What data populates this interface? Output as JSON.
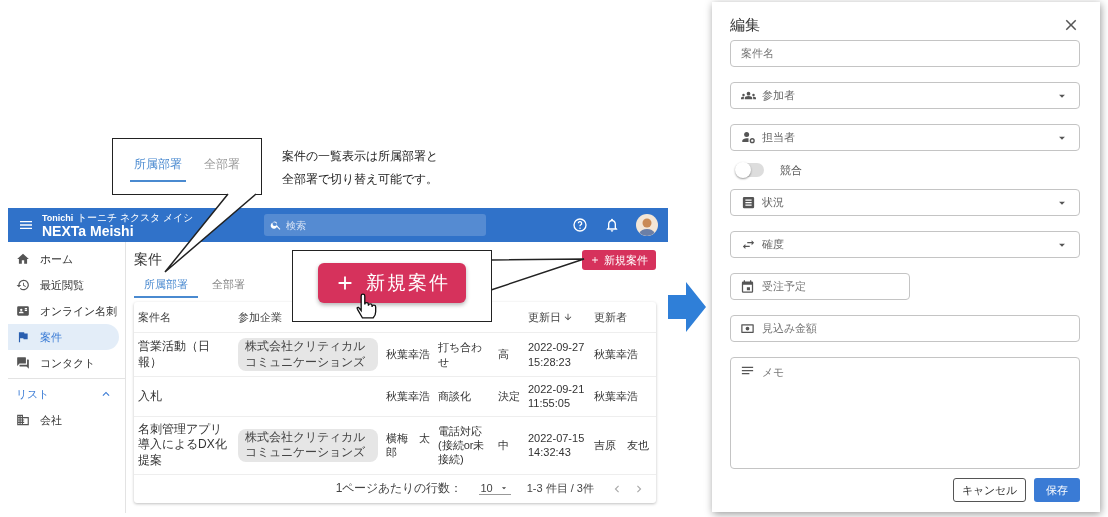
{
  "annotations": {
    "tab_bubble": {
      "tabs": [
        {
          "label": "所属部署",
          "selected": true
        },
        {
          "label": "全部署",
          "selected": false
        }
      ]
    },
    "caption": "案件の一覧表示は所属部署と全部署で切り替え可能です。",
    "button_callout": {
      "label": "新規案件"
    }
  },
  "app": {
    "header": {
      "brand_top": "Tonichi",
      "brand_kana": "トーニチ ネクスタ メイシ",
      "brand": "NEXTa Meishi",
      "search_placeholder": "検索"
    },
    "sidebar": [
      {
        "kind": "item",
        "label": "ホーム",
        "selected": false
      },
      {
        "kind": "item",
        "label": "最近閲覧",
        "selected": false
      },
      {
        "kind": "item",
        "label": "オンライン名刺",
        "selected": false
      },
      {
        "kind": "item",
        "label": "案件",
        "selected": true
      },
      {
        "kind": "item",
        "label": "コンタクト",
        "selected": false
      },
      {
        "kind": "section",
        "label": "リスト",
        "expanded": true
      },
      {
        "kind": "item",
        "label": "会社",
        "selected": false
      }
    ],
    "page_title": "案件",
    "new_button": "新規案件",
    "tabs": [
      {
        "label": "所属部署",
        "selected": true
      },
      {
        "label": "全部署",
        "selected": false
      }
    ],
    "table": {
      "columns": [
        {
          "label": "案件名"
        },
        {
          "label": "参加企業"
        },
        {
          "label": "更新日"
        },
        {
          "label": "更新者"
        }
      ],
      "rows": [
        {
          "name": "営業活動（日報）",
          "company": "株式会社クリティカルコミュニケーションズ",
          "owner": "秋葉幸浩",
          "activity": "打ち合わせ",
          "certainty": "高",
          "updated": "2022-09-27 15:28:23",
          "updated_by": "秋葉幸浩"
        },
        {
          "name": "入札",
          "owner": "秋葉幸浩",
          "activity": "商談化",
          "certainty": "決定",
          "updated": "2022-09-21 11:55:05",
          "updated_by": "秋葉幸浩"
        },
        {
          "name": "名刺管理アプリ導入によるDX化提案",
          "company": "株式会社クリティカルコミュニケーションズ",
          "owner": "横梅　太郎",
          "activity": "電話対応 (接続or未接続)",
          "certainty": "中",
          "updated": "2022-07-15 14:32:43",
          "updated_by": "吉原　友也"
        }
      ]
    },
    "pagination": {
      "rows_per_page_label": "1ページあたりの行数：",
      "rows_per_page": "10",
      "range": "1-3 件目 / 3件"
    }
  },
  "dialog": {
    "title": "編集",
    "fields": [
      {
        "kind": "text",
        "placeholder": "案件名"
      },
      {
        "kind": "select",
        "label": "参加者"
      },
      {
        "kind": "select",
        "label": "担当者"
      },
      {
        "kind": "toggle",
        "label": "競合",
        "on": false
      },
      {
        "kind": "select",
        "label": "状況"
      },
      {
        "kind": "select",
        "label": "確度"
      },
      {
        "kind": "date",
        "placeholder": "受注予定"
      },
      {
        "kind": "text",
        "placeholder": "見込み金額"
      },
      {
        "kind": "textarea",
        "placeholder": "メモ"
      }
    ],
    "buttons": [
      {
        "label": "キャンセル",
        "kind": "outlined"
      },
      {
        "label": "保存",
        "kind": "primary"
      }
    ]
  }
}
